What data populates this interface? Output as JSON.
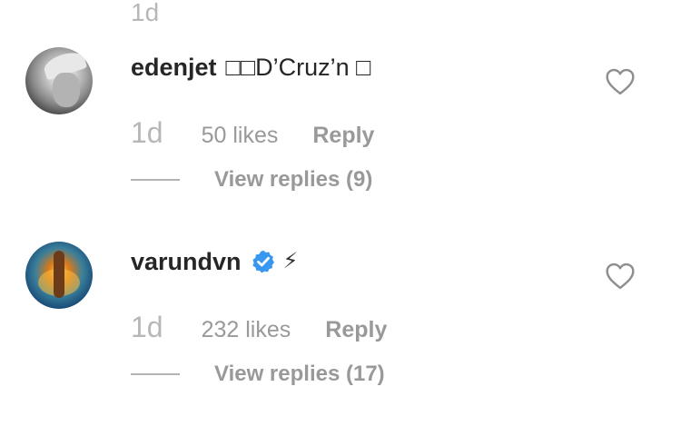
{
  "top_time": "1d",
  "comments": [
    {
      "username": "edenjet",
      "text": "□□D’Cruz’n □",
      "verified": false,
      "time": "1d",
      "likes": "50 likes",
      "reply_label": "Reply",
      "view_replies": "View replies (9)",
      "avatar_icon": "avatar-photo-grayscale",
      "like_icon": "heart-outline-icon"
    },
    {
      "username": "varundvn",
      "text": "⚡",
      "verified": true,
      "time": "1d",
      "likes": "232 likes",
      "reply_label": "Reply",
      "view_replies": "View replies (17)",
      "avatar_icon": "avatar-photo-color",
      "like_icon": "heart-outline-icon"
    }
  ],
  "colors": {
    "text_primary": "#262626",
    "text_secondary": "#999999",
    "time_gray": "#b7b7b7",
    "verified_blue": "#3897f0"
  }
}
